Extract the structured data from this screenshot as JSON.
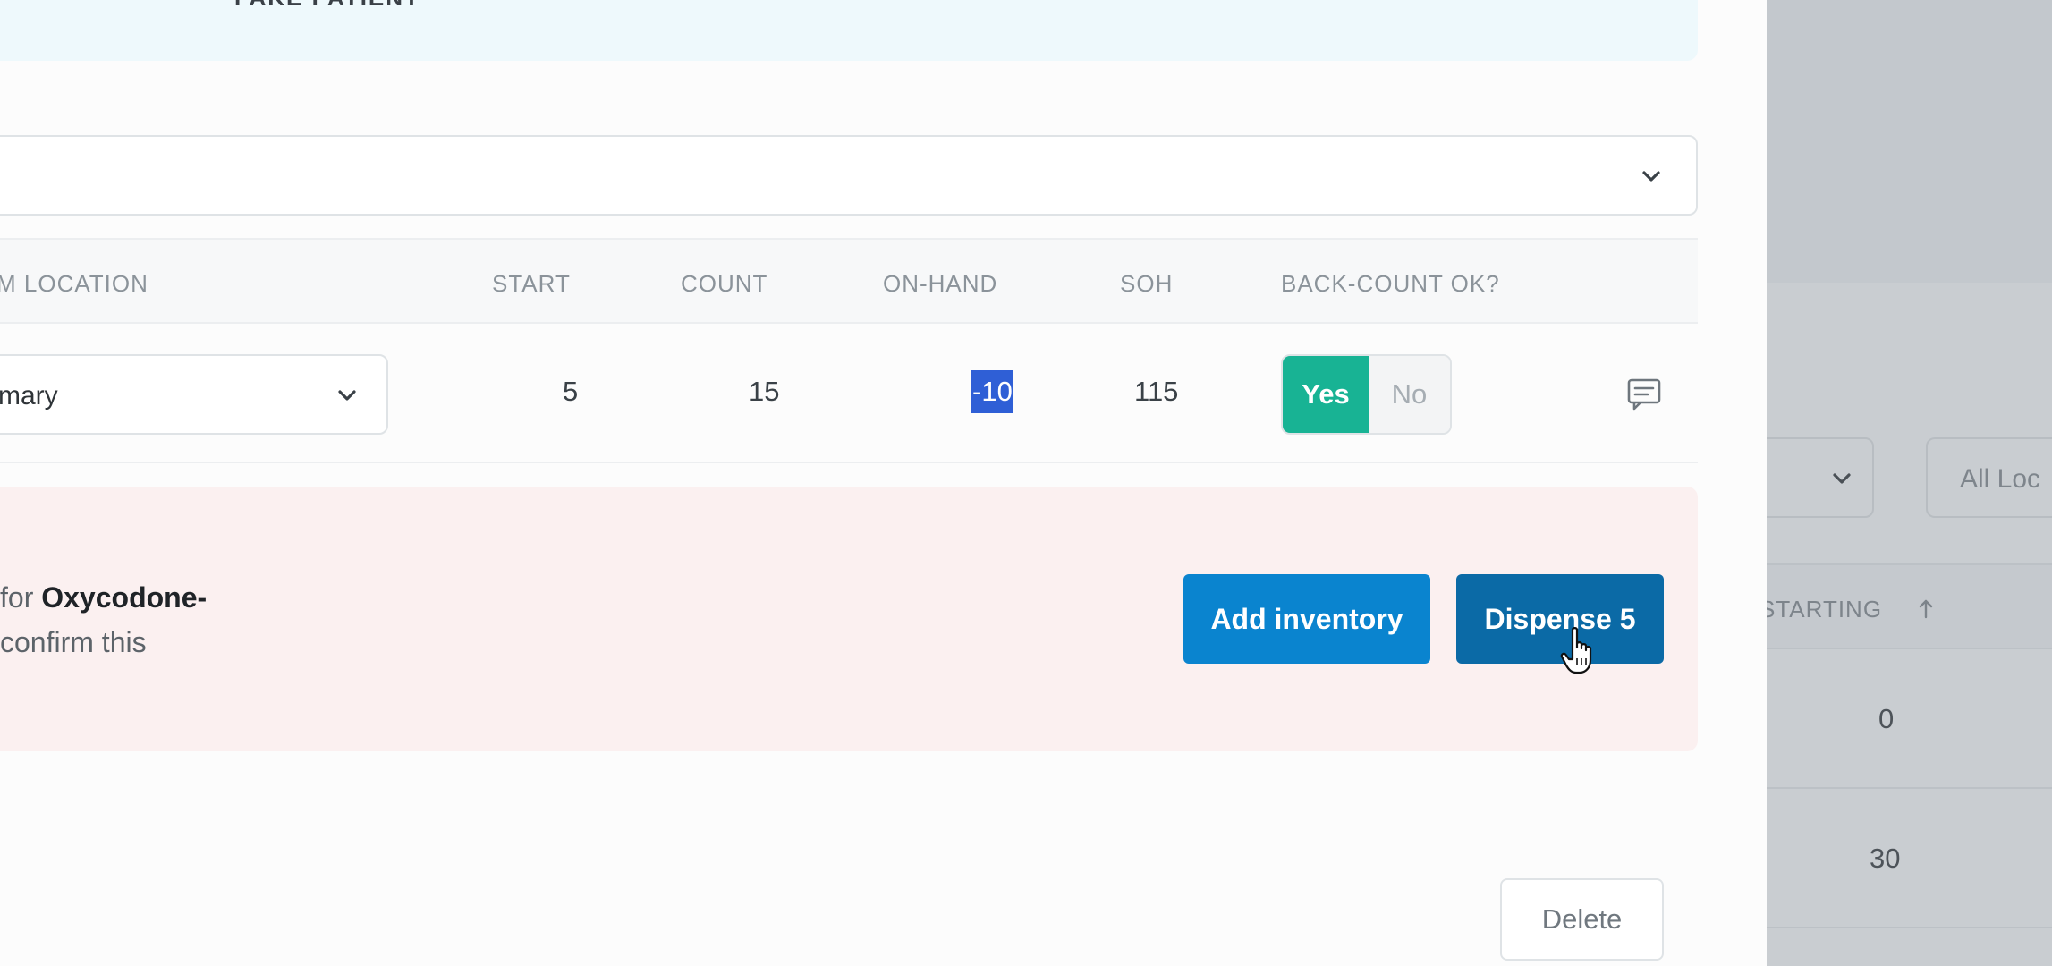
{
  "banner": {
    "label": "FAKE PATIENT"
  },
  "table": {
    "headers": {
      "location": "M LOCATION",
      "start": "START",
      "count": "COUNT",
      "on_hand": "ON-HAND",
      "soh": "SOH",
      "back_count": "BACK-COUNT OK?"
    },
    "row": {
      "location": "mary",
      "start": "5",
      "count": "15",
      "on_hand": "-10",
      "soh": "115",
      "back_count_yes": "Yes",
      "back_count_no": "No",
      "back_count_selected": "Yes"
    }
  },
  "alert": {
    "line1_prefix": "for ",
    "line1_bold": "Oxycodone-",
    "line2": "confirm this"
  },
  "buttons": {
    "add_inventory": "Add inventory",
    "dispense": "Dispense 5",
    "delete": "Delete"
  },
  "background_page": {
    "filter_placeholder": "All Loc",
    "column_header": "STARTING",
    "rows": [
      "0",
      "30"
    ]
  },
  "colors": {
    "yes_accent": "#18b394",
    "add_button": "#0a84cf",
    "dispense_button": "#0b6aa6",
    "alert_background": "#fbf0f0",
    "selection_highlight": "#2f5fd6"
  },
  "icons": {
    "select_chevron": "chevron-down-icon",
    "comment": "comment-icon",
    "sort": "arrow-up-icon",
    "cursor": "hand-pointer-icon"
  }
}
